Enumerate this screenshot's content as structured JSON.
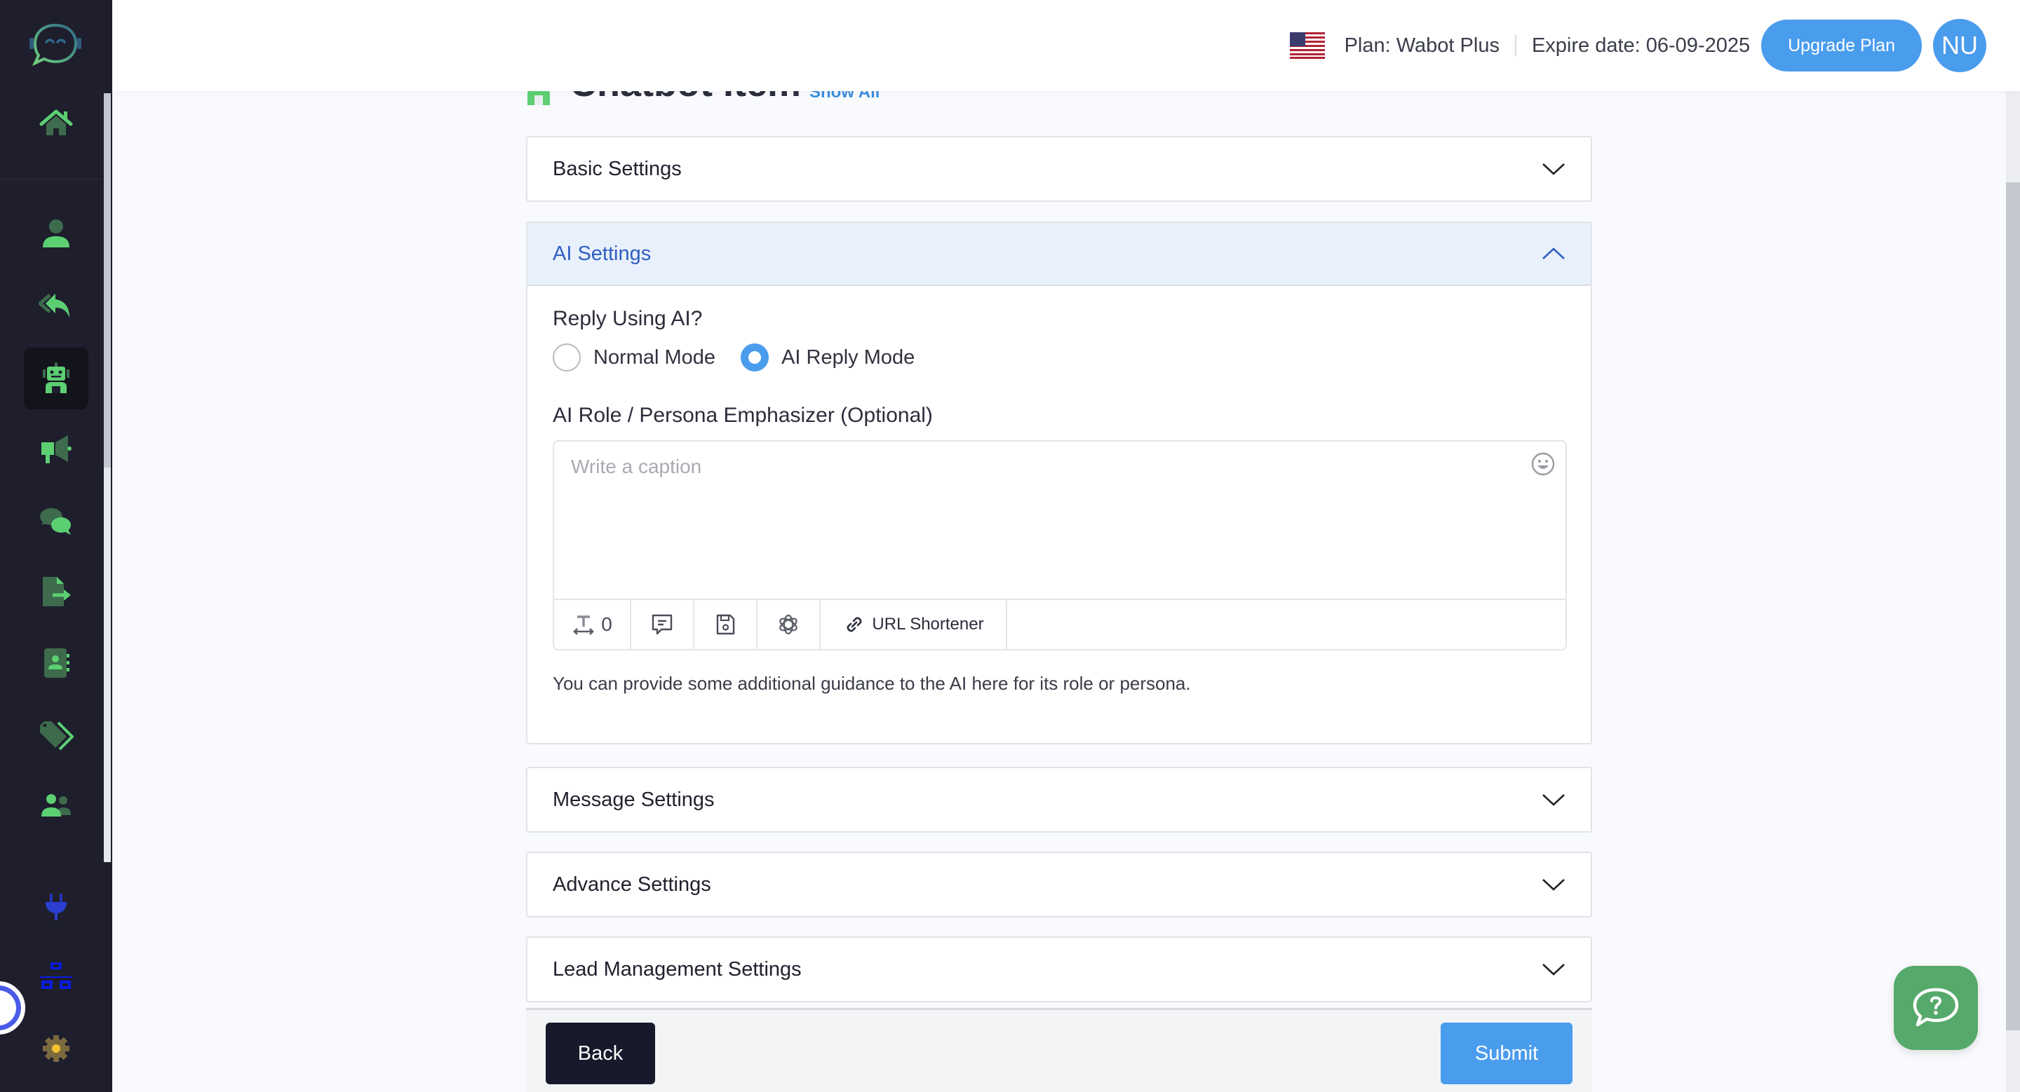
{
  "header": {
    "flag_icon": "us-flag-icon",
    "plan_text": "Plan: Wabot Plus",
    "expire_text": "Expire date: 06-09-2025",
    "upgrade_label": "Upgrade Plan",
    "avatar_initials": "NU"
  },
  "sidebar": {
    "logo": "chatbot-logo",
    "items": [
      {
        "name": "home",
        "icon": "home-icon",
        "active": false
      },
      {
        "name": "contacts",
        "icon": "user-icon",
        "active": false
      },
      {
        "name": "replies",
        "icon": "reply-all-icon",
        "active": false
      },
      {
        "name": "chatbot",
        "icon": "robot-icon",
        "active": true
      },
      {
        "name": "campaigns",
        "icon": "megaphone-icon",
        "active": false
      },
      {
        "name": "chats",
        "icon": "comments-icon",
        "active": false
      },
      {
        "name": "export",
        "icon": "file-export-icon",
        "active": false
      },
      {
        "name": "address-book",
        "icon": "address-book-icon",
        "active": false
      },
      {
        "name": "tags",
        "icon": "tags-icon",
        "active": false
      },
      {
        "name": "team",
        "icon": "users-icon",
        "active": false
      },
      {
        "name": "integrations",
        "icon": "plug-icon",
        "active": false
      },
      {
        "name": "network",
        "icon": "sitemap-icon",
        "active": false
      },
      {
        "name": "settings",
        "icon": "gear-icon",
        "active": false
      }
    ]
  },
  "page": {
    "title": "Chatbot Item",
    "show_all": "Show All"
  },
  "accordions": [
    {
      "label": "Basic Settings",
      "expanded": false
    },
    {
      "label": "AI Settings",
      "expanded": true
    },
    {
      "label": "Message Settings",
      "expanded": false
    },
    {
      "label": "Advance Settings",
      "expanded": false
    },
    {
      "label": "Lead Management Settings",
      "expanded": false
    }
  ],
  "ai_settings": {
    "reply_question": "Reply Using AI?",
    "options": [
      {
        "label": "Normal Mode",
        "checked": false
      },
      {
        "label": "AI Reply Mode",
        "checked": true
      }
    ],
    "persona_label": "AI Role / Persona Emphasizer (Optional)",
    "caption_placeholder": "Write a caption",
    "caption_value": "",
    "char_count": "0",
    "toolbar": {
      "count_icon": "text-width-icon",
      "comment_icon": "comment-icon",
      "save_icon": "floppy-disk-icon",
      "openai_icon": "openai-icon",
      "url_shortener": "URL Shortener"
    },
    "help_text": "You can provide some additional guidance to the AI here for its role or persona."
  },
  "footer": {
    "back_label": "Back",
    "submit_label": "Submit"
  },
  "colors": {
    "accent": "#4a9ced",
    "sidebar_bg": "#1e1e2d",
    "icon_green": "#5ccf72",
    "icon_green_dark": "#3d6b4c",
    "help_fab": "#55a96a"
  }
}
